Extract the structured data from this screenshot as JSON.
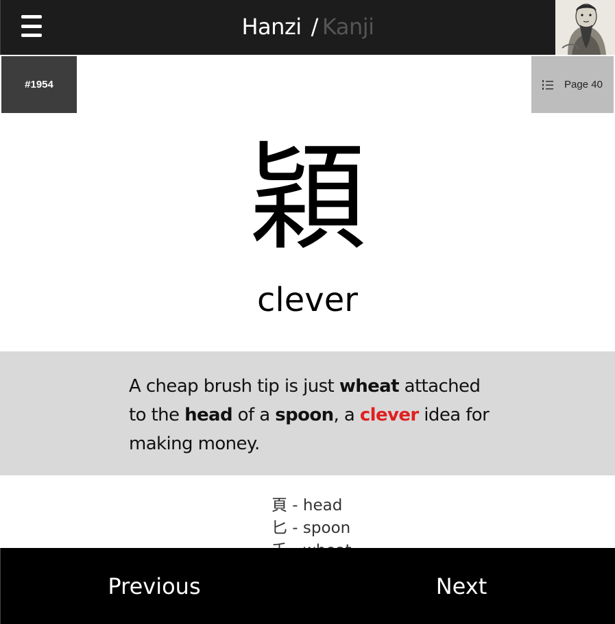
{
  "header": {
    "title_primary": "Hanzi",
    "title_separator": "/",
    "title_secondary": "Kanji"
  },
  "badges": {
    "number": "#1954",
    "page": "Page 40"
  },
  "card": {
    "character": "穎",
    "keyword": "clever"
  },
  "story": {
    "seg1": "A cheap brush tip is just ",
    "w1": "wheat",
    "seg2": " attached to the ",
    "w2": "head",
    "seg3": " of a ",
    "w3": "spoon",
    "seg4": ", a ",
    "keyword": "clever",
    "seg5": " idea for making money."
  },
  "components": [
    {
      "char": "頁",
      "meaning": "head"
    },
    {
      "char": "匕",
      "meaning": "spoon"
    },
    {
      "char": "禾",
      "meaning": "wheat"
    }
  ],
  "footer": {
    "previous": "Previous",
    "next": "Next"
  },
  "colors": {
    "header_bg": "#1c1c1c",
    "number_badge_bg": "#3d3d3d",
    "page_badge_bg": "#bdbdbd",
    "story_bg": "#d9d9d9",
    "highlight": "#e02020",
    "footer_bg": "#000000"
  }
}
